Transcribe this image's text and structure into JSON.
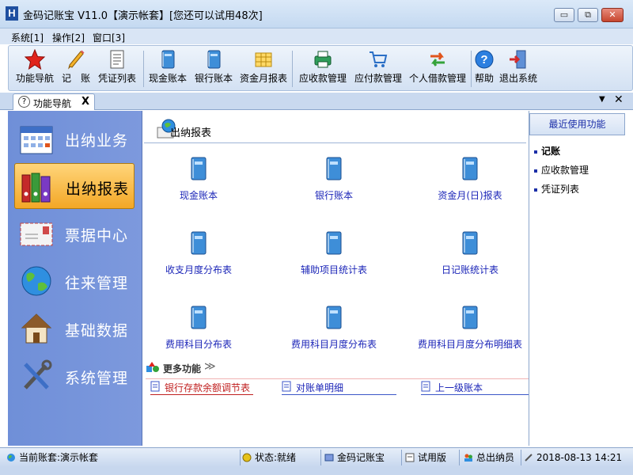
{
  "window": {
    "title": "金码记账宝 V11.0【演示帐套】[您还可以试用48次]",
    "minimize_glyph": "▭",
    "restore_glyph": "⧉",
    "close_glyph": "✕"
  },
  "menu": [
    {
      "label": "系统[1]"
    },
    {
      "label": "操作[2]"
    },
    {
      "label": "窗口[3]"
    }
  ],
  "toolbar": [
    {
      "label": "功能导航",
      "icon": "star-icon"
    },
    {
      "label": "记　账",
      "icon": "pencil-icon"
    },
    {
      "label": "凭证列表",
      "icon": "document-icon"
    },
    {
      "label": "现金账本",
      "icon": "book-icon"
    },
    {
      "label": "银行账本",
      "icon": "book-icon"
    },
    {
      "label": "资金月报表",
      "icon": "grid-icon"
    },
    {
      "label": "应收款管理",
      "icon": "printer-icon"
    },
    {
      "label": "应付款管理",
      "icon": "cart-icon"
    },
    {
      "label": "个人借款管理",
      "icon": "exchange-icon"
    },
    {
      "label": "帮助",
      "icon": "help-icon"
    },
    {
      "label": "退出系统",
      "icon": "exit-icon"
    }
  ],
  "tab": {
    "label": "功能导航",
    "close": "X"
  },
  "tabstrip": {
    "dropdown": "▼",
    "close": "✕"
  },
  "nav": [
    {
      "label": "出纳业务",
      "icon": "calendar-icon",
      "active": false
    },
    {
      "label": "出纳报表",
      "icon": "binders-icon",
      "active": true
    },
    {
      "label": "票据中心",
      "icon": "envelope-icon",
      "active": false
    },
    {
      "label": "往来管理",
      "icon": "globe-icon",
      "active": false
    },
    {
      "label": "基础数据",
      "icon": "house-icon",
      "active": false
    },
    {
      "label": "系统管理",
      "icon": "tools-icon",
      "active": false
    }
  ],
  "content": {
    "title": "出纳报表",
    "reports": [
      {
        "label": "现金账本"
      },
      {
        "label": "银行账本"
      },
      {
        "label": "资金月(日)报表"
      },
      {
        "label": "收支月度分布表"
      },
      {
        "label": "辅助项目统计表"
      },
      {
        "label": "日记账统计表"
      },
      {
        "label": "费用科目分布表"
      },
      {
        "label": "费用科目月度分布表"
      },
      {
        "label": "费用科目月度分布明细表"
      }
    ],
    "more": {
      "label": "更多功能",
      "arrow": "≫"
    },
    "links": [
      {
        "label": "银行存款余额调节表",
        "color": "#c02020"
      },
      {
        "label": "对账单明细",
        "color": "#1c26b8"
      },
      {
        "label": "上一级账本",
        "color": "#1c26b8"
      }
    ]
  },
  "recent": {
    "title": "最近使用功能",
    "items": [
      {
        "label": "记账",
        "bold": true
      },
      {
        "label": "应收款管理",
        "bold": false
      },
      {
        "label": "凭证列表",
        "bold": false
      }
    ]
  },
  "status": {
    "account": "当前账套:演示帐套",
    "state": "状态:就绪",
    "product": "金码记账宝",
    "edition": "试用版",
    "user": "总出纳员",
    "datetime": "2018-08-13 14:21"
  },
  "colors": {
    "accent": "#7d99dd",
    "active_nav": "#f3a726",
    "link_blue": "#1c26b8"
  }
}
